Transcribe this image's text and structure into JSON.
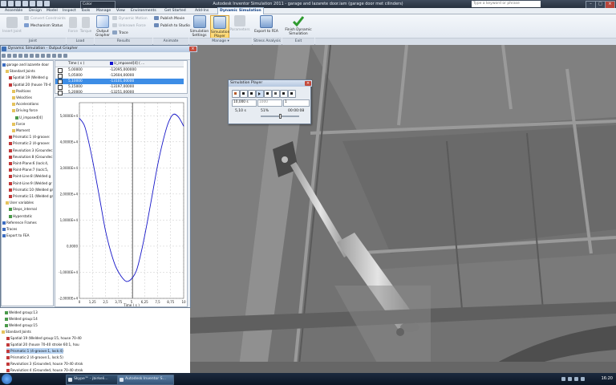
{
  "window": {
    "title": "Autodesk Inventor Simulation 2011 - garage and lazarete door.iam (garage door met cilinders)",
    "color_dropdown": "Color",
    "search_placeholder": "Type a keyword or phrase",
    "minimize": "–",
    "maximize": "□",
    "close": "×"
  },
  "tabs": [
    "Assemble",
    "Design",
    "Model",
    "Inspect",
    "Tools",
    "Manage",
    "View",
    "Environments",
    "Get Started",
    "Add-Ins",
    "Dynamic Simulation"
  ],
  "ribbon": {
    "joint": {
      "insert_joint": "Insert Joint",
      "convert_constraints": "Convert Constraints",
      "mechanism_status": "Mechanism Status",
      "label": "Joint"
    },
    "load": {
      "force": "Force",
      "torque": "Torque",
      "label": "Load"
    },
    "results": {
      "output_grapher": "Output Grapher",
      "dynamic_motion": "Dynamic Motion",
      "unknown_force": "Unknown Force",
      "trace": "Trace",
      "label": "Results"
    },
    "animate": {
      "publish_movie": "Publish Movie",
      "publish_studio": "Publish to Studio",
      "label": "Animate"
    },
    "manage": {
      "simulation_settings": "Simulation Settings",
      "simulation_player": "Simulation Player",
      "parameters": "Parameters",
      "label": "Manage ▾"
    },
    "stress": {
      "export_fea": "Export to FEA",
      "label": "Stress Analysis"
    },
    "exit": {
      "finish": "Finish Dynamic Simulation",
      "label": "Exit"
    }
  },
  "grapher": {
    "title": "Dynamic Simulation - Output Grapher",
    "close": "×",
    "tree": [
      "garage and lazarete door",
      "Standard Joints",
      "Spatial:19 (Welded g",
      "Spatial:20 (house 70-4",
      "Positions",
      "Velocities",
      "Accelerations",
      "Driving force",
      "U_imposed[4]",
      "Force",
      "Moment",
      "Prismatic:1 (4-groove:",
      "Prismatic:2 (4-groove:",
      "Revolution:3 (Groundec",
      "Revolution:8 (Groundec",
      "Point-Plane:6 (lock:4,",
      "Point-Plane:7 (lock:5,",
      "Point-Line:8 (Welded g",
      "Point-Line:9 (Welded gr",
      "Prismatic:10 (Welded gr",
      "Prismatic:11 (Welded gr",
      "User variables",
      "Steps_internal",
      "Hyperstatic",
      "Reference Frames",
      "Traces",
      "Export to FEA"
    ],
    "table": {
      "col_time": "Time ( s )",
      "col_value": "U_imposed[4] ( ...",
      "rows": [
        {
          "time": "5,00000",
          "value": "-12095,000000"
        },
        {
          "time": "5,05000",
          "value": "-12604,00000"
        },
        {
          "time": "5,10000",
          "value": "-13101,00000"
        },
        {
          "time": "5,15000",
          "value": "-13197,00000"
        },
        {
          "time": "5,20000",
          "value": "-13251,00000"
        }
      ]
    }
  },
  "chart_data": {
    "type": "line",
    "xlabel": "Time ( s )",
    "ylabel": "",
    "xlim": [
      0,
      10
    ],
    "ylim": [
      -20000,
      55000
    ],
    "xticks": [
      "0",
      "1,25",
      "2,5",
      "3,75",
      "5",
      "6,25",
      "7,5",
      "8,75",
      "10"
    ],
    "yticks": [
      {
        "value": 50000,
        "label": "5,0000E+4"
      },
      {
        "value": 40000,
        "label": "4,0000E+4"
      },
      {
        "value": 30000,
        "label": "3,0000E+4"
      },
      {
        "value": 20000,
        "label": "2,0000E+4"
      },
      {
        "value": 10000,
        "label": "1,0000E+4"
      },
      {
        "value": 0,
        "label": "0,0000"
      },
      {
        "value": -10000,
        "label": "-1,0000E+4"
      },
      {
        "value": -20000,
        "label": "-2,0000E+4"
      }
    ],
    "cursor_x": 5.1,
    "series": [
      {
        "name": "U_imposed[4]",
        "color": "#1515c8",
        "x": [
          0,
          0.5,
          1,
          1.5,
          2,
          2.5,
          3,
          3.5,
          4,
          4.5,
          5,
          5.5,
          6,
          6.5,
          7,
          7.5,
          8,
          8.5,
          9,
          9.5,
          10
        ],
        "y": [
          49000,
          46000,
          38000,
          28000,
          17000,
          6000,
          -2000,
          -8000,
          -11500,
          -13500,
          -12500,
          -9000,
          -1000,
          9000,
          20000,
          31000,
          40000,
          47000,
          50500,
          49500,
          46000
        ]
      }
    ]
  },
  "player": {
    "title": "Simulation Player",
    "close": "×",
    "end_time": "10,000 s",
    "images": "1000",
    "filter": "1",
    "current_time": "5,10 s",
    "percent": "51%",
    "elapsed": "00:00:08"
  },
  "taskbar": {
    "tasks": [
      "Skype™ - jbirkeli...",
      "Autodesk Inventor S..."
    ],
    "clock": "16:20"
  },
  "colors": {
    "ribbon_bg": "#e6ecf4",
    "selection": "#3d8de6",
    "curve": "#1515c8",
    "viewport": "#707070"
  }
}
